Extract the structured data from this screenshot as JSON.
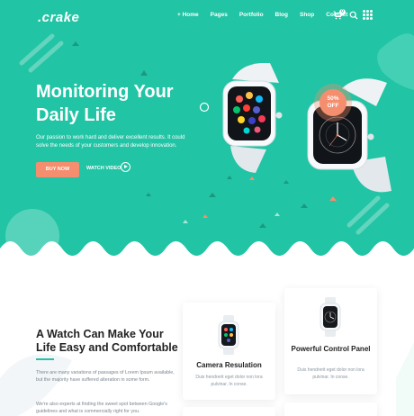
{
  "brand": {
    "logo": ".crake"
  },
  "nav": {
    "items": [
      "+ Home",
      "Pages",
      "Portfolio",
      "Blog",
      "Shop",
      "Contact"
    ],
    "cart_count": "0"
  },
  "hero": {
    "title": "Monitoring Your Daily Life",
    "description": "Our passion to work hard and deliver excellent results. It could solve the needs of your customers and develop innovation.",
    "buy_label": "BUY NOW",
    "watch_label": "WATCH VIDEO",
    "sale_percent": "50%",
    "sale_label": "OFF"
  },
  "about": {
    "title": "A Watch Can Make Your Life Easy and Comfortable",
    "p1": "There are many variations of passages of Lorem Ipsum available, but the majority have suffered alteration in some form.",
    "p2": "We're also experts at finding the sweet spot between Google's guidelines and what is commercially right for you."
  },
  "features": [
    {
      "title": "Camera Resulation",
      "text": "Duis hendrerit eget dolor non lora pulvinar. In conse."
    },
    {
      "title": "Powerful Control Panel",
      "text": "Duis hendrerit eget dolor non lora pulvinar. In conse."
    }
  ],
  "colors": {
    "primary": "#21c4a4",
    "accent": "#f58e6e",
    "text_dark": "#222222",
    "text_muted": "#7a8691"
  },
  "icons": [
    "cart-icon",
    "search-icon",
    "grid-menu-icon",
    "play-icon"
  ]
}
